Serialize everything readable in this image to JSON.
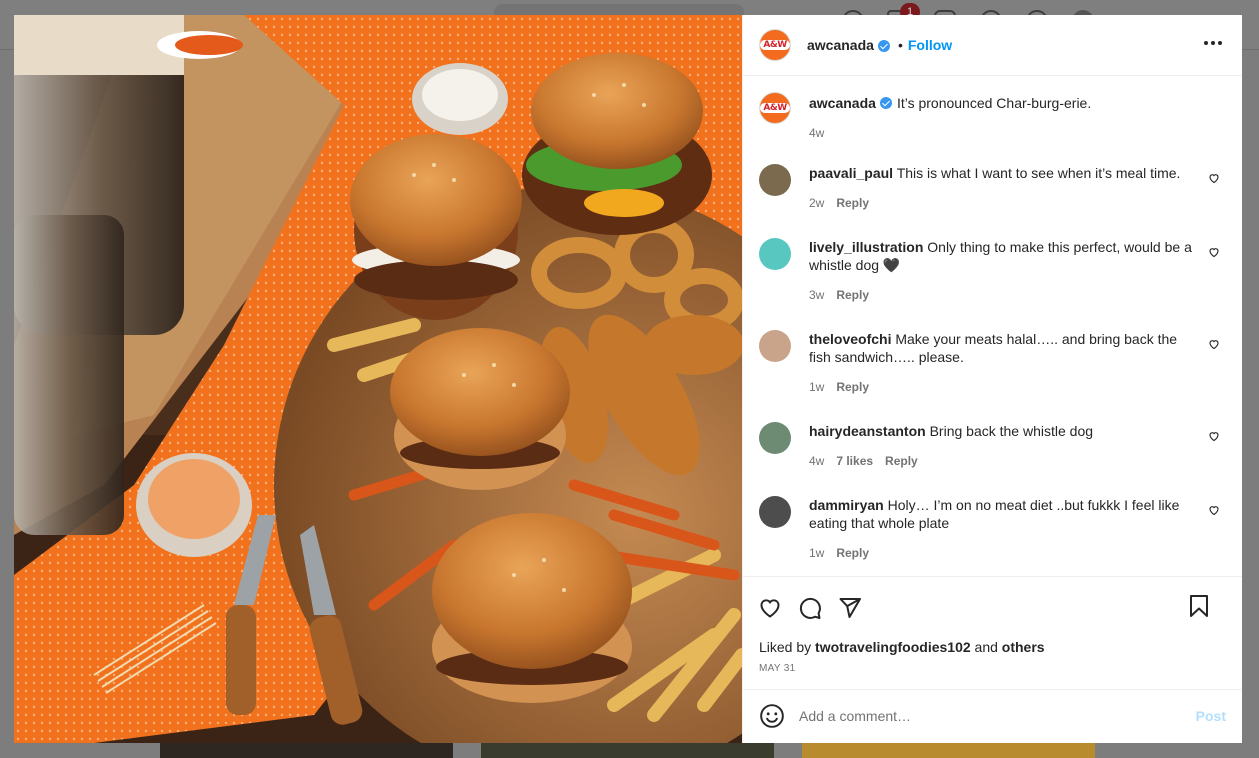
{
  "background": {
    "notification_count": "1"
  },
  "post": {
    "account": {
      "username": "awcanada",
      "logo_text": "A&W",
      "follow_label": "Follow",
      "separator": "•"
    },
    "caption": {
      "username": "awcanada",
      "text": "It’s pronounced Char-burg-erie.",
      "age": "4w"
    },
    "comments": [
      {
        "username": "paavali_paul",
        "text": "This is what I want to see when it’s meal time.",
        "age": "2w",
        "likes": "",
        "reply_label": "Reply",
        "avatar_color": "#7c6a4e"
      },
      {
        "username": "lively_illustration",
        "text": "Only thing to make this perfect, would be a whistle dog 🖤",
        "age": "3w",
        "likes": "",
        "reply_label": "Reply",
        "avatar_color": "#58c7c0"
      },
      {
        "username": "theloveofchi",
        "text": "Make your meats halal….. and bring back the fish sandwich….. please.",
        "age": "1w",
        "likes": "",
        "reply_label": "Reply",
        "avatar_color": "#c9a48a"
      },
      {
        "username": "hairydeanstanton",
        "text": "Bring back the whistle dog",
        "age": "4w",
        "likes": "7 likes",
        "reply_label": "Reply",
        "avatar_color": "#6d8a73"
      },
      {
        "username": "dammiryan",
        "text": "Holy… I’m on no meat diet ..but fukkk I feel like eating that whole plate",
        "age": "1w",
        "likes": "",
        "reply_label": "Reply",
        "avatar_color": "#4d4d4d"
      }
    ],
    "liked_by": {
      "prefix": "Liked by",
      "user": "twotravelingfoodies102",
      "and": "and",
      "others": "others"
    },
    "date": "MAY 31",
    "add_comment": {
      "placeholder": "Add a comment…",
      "post_label": "Post"
    },
    "icons": {
      "like": "heart-icon",
      "comment": "comment-icon",
      "share": "share-icon",
      "save": "bookmark-icon",
      "emoji": "emoji-icon",
      "more": "more-options-icon",
      "verified": "verified-badge-icon"
    },
    "colors": {
      "brand_orange": "#f26b1f",
      "link_blue": "#0095f6",
      "verified_blue": "#3797f0",
      "post_disabled": "#b2dffc"
    }
  }
}
